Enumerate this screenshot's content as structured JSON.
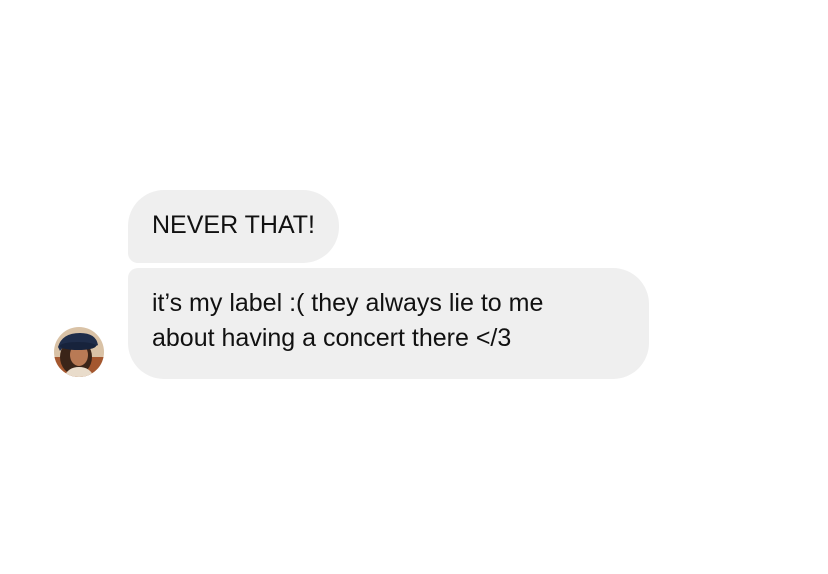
{
  "conversation": {
    "messages": [
      {
        "text": "NEVER THAT!"
      },
      {
        "lines": [
          "it’s my label :( they always lie to me",
          "about having a concert there </3"
        ]
      }
    ],
    "avatar": {
      "icon": "user-avatar-photo"
    },
    "colors": {
      "bubble": "#efefef",
      "text": "#111111",
      "background": "#ffffff"
    }
  }
}
